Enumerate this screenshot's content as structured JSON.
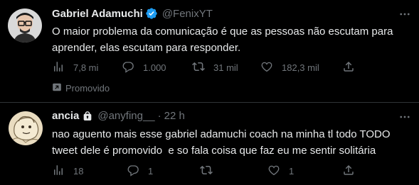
{
  "tweets": [
    {
      "name": "Gabriel Adamuchi",
      "handle": "@FenixYT",
      "text_lines": [
        "O maior problema da comunicação é que as pessoas não escutam para",
        "aprender, elas escutam para responder."
      ],
      "views": "7,8 mi",
      "replies": "1.000",
      "retweets": "31 mil",
      "likes": "182,3 mil",
      "promoted_label": "Promovido"
    },
    {
      "name": "ancia",
      "handle": "@anyfing__",
      "separator": "·",
      "time": "22 h",
      "text_lines": [
        "nao aguento mais esse gabriel adamuchi coach na minha tl todo TODO",
        "tweet dele é promovido  e so fala coisa que faz eu me sentir solitária"
      ],
      "views": "18",
      "replies": "1",
      "retweets": "",
      "likes": "1"
    }
  ],
  "colors": {
    "background": "#000000",
    "text_primary": "#e7e9ea",
    "text_secondary": "#71767b",
    "verified_blue": "#1d9bf0",
    "divider": "#2f3336"
  },
  "icons": [
    "verified-badge-icon",
    "lock-icon",
    "more-icon",
    "views-icon",
    "reply-icon",
    "retweet-icon",
    "like-icon",
    "share-icon",
    "promoted-icon"
  ]
}
